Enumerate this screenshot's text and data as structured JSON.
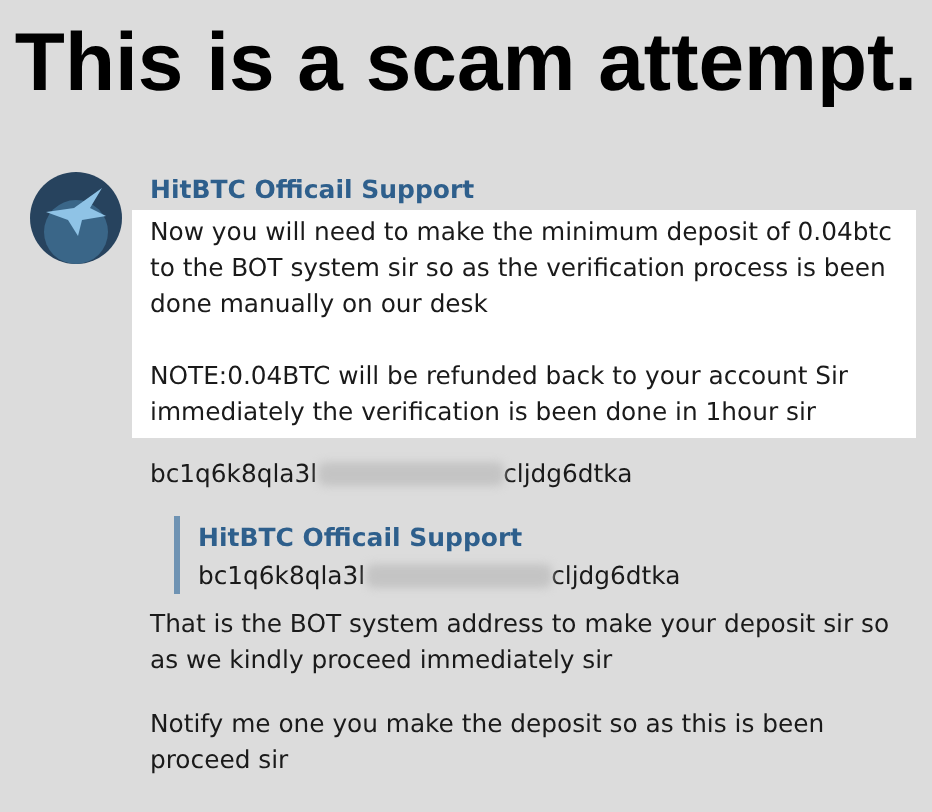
{
  "banner": {
    "title": "This is a scam attempt."
  },
  "message": {
    "sender": "HitBTC Officail Support",
    "highlighted_paragraphs": [
      "Now you will need to make the minimum deposit of 0.04btc to the BOT system sir so as the verification process is been done manually on our desk",
      "NOTE:0.04BTC will be refunded back to your account Sir immediately the verification is been done in 1hour sir"
    ],
    "address": {
      "start": "bc1q6k8qla3l",
      "end": "cljdg6dtka"
    },
    "reply_quote": {
      "sender": "HitBTC Officail Support",
      "address": {
        "start": "bc1q6k8qla3l",
        "end": "cljdg6dtka"
      }
    },
    "paragraphs": [
      "That is the BOT system address to make your deposit sir so as we kindly proceed immediately sir",
      "Notify me one you make the deposit so as this is been proceed sir"
    ]
  }
}
